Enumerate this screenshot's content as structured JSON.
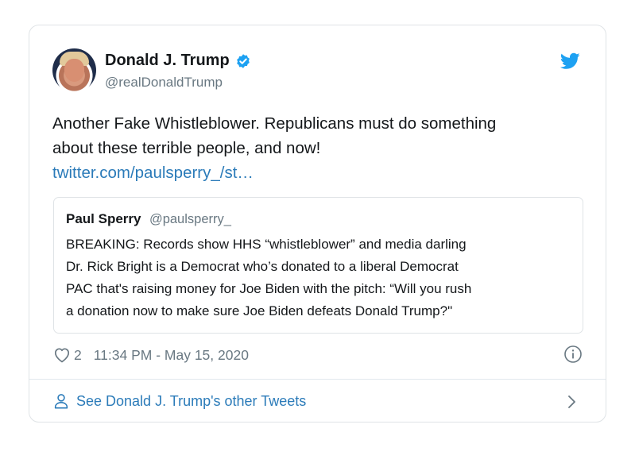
{
  "tweet": {
    "display_name": "Donald J. Trump",
    "handle": "@realDonaldTrump",
    "verified": true,
    "text_lines": [
      "Another Fake Whistleblower. Republicans must do something",
      "about these terrible people, and now!"
    ],
    "link_text": "twitter.com/paulsperry_/st…",
    "likes": "2",
    "timestamp": "11:34 PM - May 15, 2020"
  },
  "quote": {
    "display_name": "Paul Sperry",
    "handle": "@paulsperry_",
    "body_lines": [
      "BREAKING: Records show HHS “whistleblower” and media darling",
      "Dr. Rick Bright is a Democrat who’s donated to a liberal Democrat",
      "PAC that's raising money for Joe Biden with the pitch: “Will you rush",
      "a donation now to make sure Joe Biden defeats Donald Trump?\""
    ]
  },
  "footer": {
    "label": "See Donald J. Trump's other Tweets"
  },
  "icons": {
    "twitter": "twitter-bird-icon",
    "verified": "verified-badge-icon",
    "like": "heart-icon",
    "info": "info-icon",
    "person": "person-icon",
    "chevron": "chevron-right-icon"
  },
  "colors": {
    "link": "#2b7bb9",
    "twitter_blue": "#1da1f2",
    "muted_text": "#697882",
    "primary_text": "#14171a",
    "border": "#dfe3e6"
  }
}
